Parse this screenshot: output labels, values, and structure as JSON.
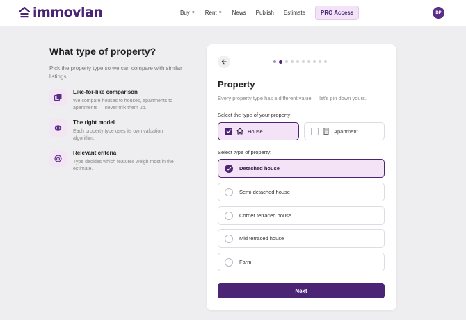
{
  "header": {
    "logo_text": "immovlan",
    "nav": [
      {
        "label": "Buy",
        "dropdown": true
      },
      {
        "label": "Rent",
        "dropdown": true
      },
      {
        "label": "News",
        "dropdown": false
      },
      {
        "label": "Publish",
        "dropdown": false
      },
      {
        "label": "Estimate",
        "dropdown": false
      }
    ],
    "pro_label": "PRO Access",
    "avatar_initials": "BP"
  },
  "intro": {
    "title": "What type of property?",
    "subtitle": "Pick the property type so we can compare with similar listings.",
    "features": [
      {
        "icon": "squares-icon",
        "title": "Like-for-like comparison",
        "desc": "We compare houses to houses, apartments to apartments — never mix them up."
      },
      {
        "icon": "brain-icon",
        "title": "The right model",
        "desc": "Each property type uses its own valuation algorithm."
      },
      {
        "icon": "target-icon",
        "title": "Relevant criteria",
        "desc": "Type decides which features weigh most in the estimate."
      }
    ]
  },
  "card": {
    "progress": {
      "total_steps": 10,
      "current_step": 2
    },
    "title": "Property",
    "subtitle": "Every property type has a different value — let's pin down yours.",
    "type_label": "Select the type of your property",
    "types": [
      {
        "label": "House",
        "icon": "house-icon",
        "selected": true
      },
      {
        "label": "Apartment",
        "icon": "building-icon",
        "selected": false
      }
    ],
    "subtype_label": "Select type of property:",
    "subtypes": [
      {
        "label": "Detached house",
        "selected": true
      },
      {
        "label": "Semi-detached house",
        "selected": false
      },
      {
        "label": "Corner terraced house",
        "selected": false
      },
      {
        "label": "Mid terraced house",
        "selected": false
      },
      {
        "label": "Farm",
        "selected": false
      }
    ],
    "next_label": "Next"
  },
  "colors": {
    "brand": "#4b2475",
    "selected_bg": "#f4e3f6",
    "page_bg": "#eeeef1"
  }
}
